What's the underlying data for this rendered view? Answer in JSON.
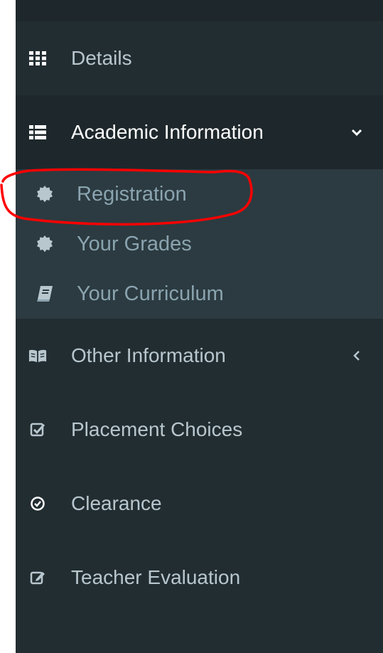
{
  "menu": {
    "details": {
      "label": "Details",
      "icon": "grid-icon"
    },
    "academic": {
      "label": "Academic Information",
      "icon": "list-icon",
      "expanded": true
    },
    "academic_sub": [
      {
        "label": "Registration",
        "icon": "badge-icon"
      },
      {
        "label": "Your Grades",
        "icon": "badge-icon"
      },
      {
        "label": "Your Curriculum",
        "icon": "book-icon"
      }
    ],
    "other": {
      "label": "Other Information",
      "icon": "open-book-icon"
    },
    "placement": {
      "label": "Placement Choices",
      "icon": "checkbox-icon"
    },
    "clearance": {
      "label": "Clearance",
      "icon": "check-circle-icon"
    },
    "evaluation": {
      "label": "Teacher Evaluation",
      "icon": "edit-icon"
    }
  },
  "colors": {
    "sidebar_bg": "#222d32",
    "active_bg": "#1e282c",
    "submenu_bg": "#2c3b41",
    "text": "#b8c7ce",
    "annotation": "#ff0000"
  }
}
